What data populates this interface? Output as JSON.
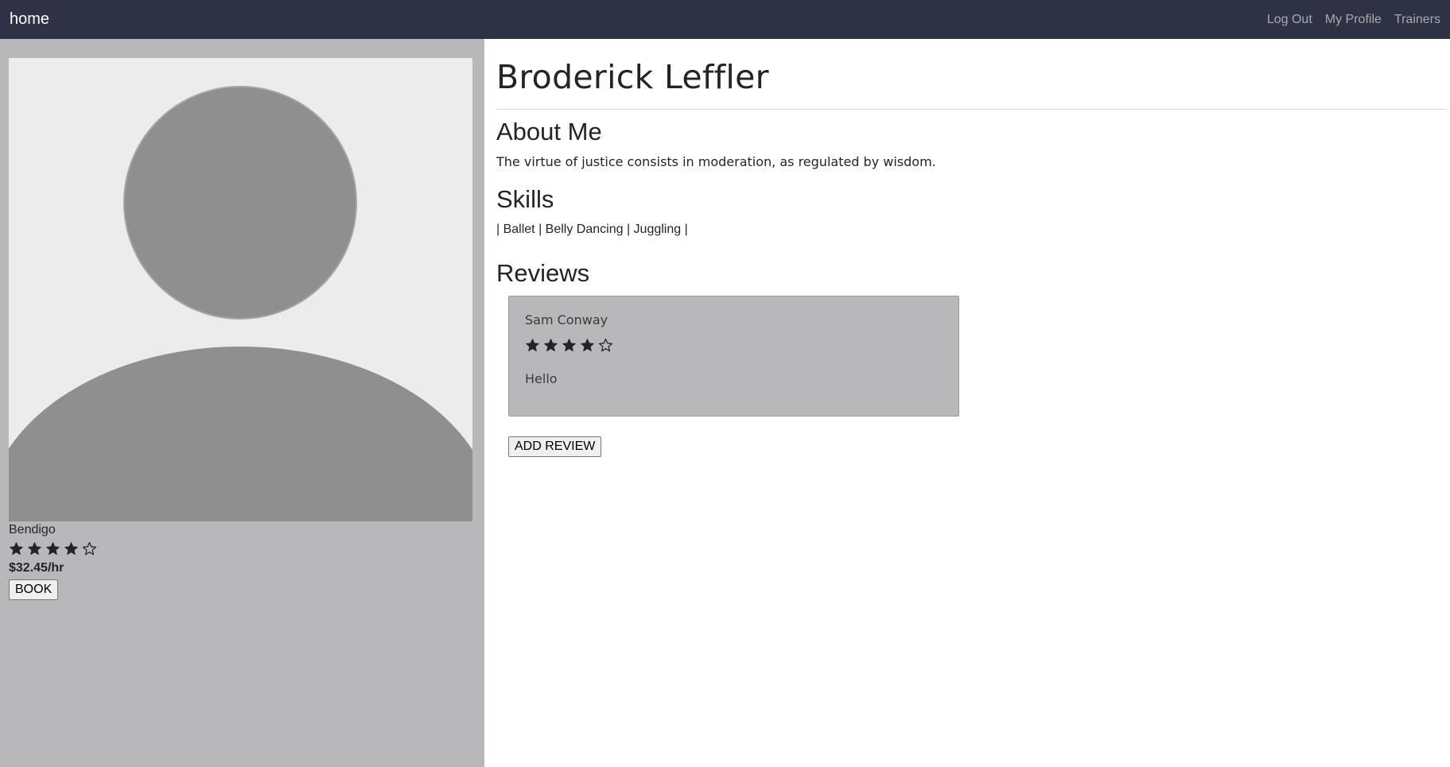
{
  "navbar": {
    "brand": "home",
    "links": [
      "Log Out",
      "My Profile",
      "Trainers"
    ]
  },
  "trainer": {
    "name": "Broderick Leffler",
    "location": "Bendigo",
    "rating": 4,
    "rating_max": 5,
    "rate": "$32.45/hr",
    "book_label": "BOOK"
  },
  "about": {
    "heading": "About Me",
    "text": "The virtue of justice consists in moderation, as regulated by wisdom."
  },
  "skills": {
    "heading": "Skills",
    "text": "| Ballet | Belly Dancing | Juggling |"
  },
  "reviews": {
    "heading": "Reviews",
    "items": [
      {
        "author": "Sam Conway",
        "rating": 4,
        "rating_max": 5,
        "text": "Hello"
      }
    ],
    "add_label": "ADD REVIEW"
  },
  "colors": {
    "navbar_bg": "#2e3244",
    "sidebar_bg": "#b8b8ba",
    "avatar_bg": "#ececec",
    "avatar_fg": "#8f8f8f",
    "star": "#212529"
  },
  "icons": {
    "star_filled": "star-filled-icon",
    "star_empty": "star-outline-icon",
    "avatar": "default-avatar-icon"
  }
}
